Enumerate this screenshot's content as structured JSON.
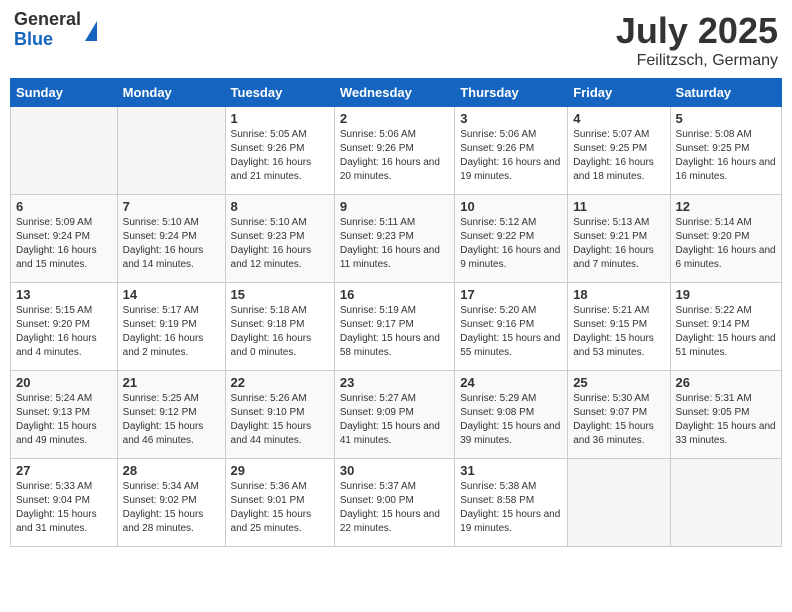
{
  "header": {
    "logo_general": "General",
    "logo_blue": "Blue",
    "title": "July 2025",
    "subtitle": "Feilitzsch, Germany"
  },
  "days_of_week": [
    "Sunday",
    "Monday",
    "Tuesday",
    "Wednesday",
    "Thursday",
    "Friday",
    "Saturday"
  ],
  "weeks": [
    [
      {
        "day": "",
        "sunrise": "",
        "sunset": "",
        "daylight": ""
      },
      {
        "day": "",
        "sunrise": "",
        "sunset": "",
        "daylight": ""
      },
      {
        "day": "1",
        "sunrise": "Sunrise: 5:05 AM",
        "sunset": "Sunset: 9:26 PM",
        "daylight": "Daylight: 16 hours and 21 minutes."
      },
      {
        "day": "2",
        "sunrise": "Sunrise: 5:06 AM",
        "sunset": "Sunset: 9:26 PM",
        "daylight": "Daylight: 16 hours and 20 minutes."
      },
      {
        "day": "3",
        "sunrise": "Sunrise: 5:06 AM",
        "sunset": "Sunset: 9:26 PM",
        "daylight": "Daylight: 16 hours and 19 minutes."
      },
      {
        "day": "4",
        "sunrise": "Sunrise: 5:07 AM",
        "sunset": "Sunset: 9:25 PM",
        "daylight": "Daylight: 16 hours and 18 minutes."
      },
      {
        "day": "5",
        "sunrise": "Sunrise: 5:08 AM",
        "sunset": "Sunset: 9:25 PM",
        "daylight": "Daylight: 16 hours and 16 minutes."
      }
    ],
    [
      {
        "day": "6",
        "sunrise": "Sunrise: 5:09 AM",
        "sunset": "Sunset: 9:24 PM",
        "daylight": "Daylight: 16 hours and 15 minutes."
      },
      {
        "day": "7",
        "sunrise": "Sunrise: 5:10 AM",
        "sunset": "Sunset: 9:24 PM",
        "daylight": "Daylight: 16 hours and 14 minutes."
      },
      {
        "day": "8",
        "sunrise": "Sunrise: 5:10 AM",
        "sunset": "Sunset: 9:23 PM",
        "daylight": "Daylight: 16 hours and 12 minutes."
      },
      {
        "day": "9",
        "sunrise": "Sunrise: 5:11 AM",
        "sunset": "Sunset: 9:23 PM",
        "daylight": "Daylight: 16 hours and 11 minutes."
      },
      {
        "day": "10",
        "sunrise": "Sunrise: 5:12 AM",
        "sunset": "Sunset: 9:22 PM",
        "daylight": "Daylight: 16 hours and 9 minutes."
      },
      {
        "day": "11",
        "sunrise": "Sunrise: 5:13 AM",
        "sunset": "Sunset: 9:21 PM",
        "daylight": "Daylight: 16 hours and 7 minutes."
      },
      {
        "day": "12",
        "sunrise": "Sunrise: 5:14 AM",
        "sunset": "Sunset: 9:20 PM",
        "daylight": "Daylight: 16 hours and 6 minutes."
      }
    ],
    [
      {
        "day": "13",
        "sunrise": "Sunrise: 5:15 AM",
        "sunset": "Sunset: 9:20 PM",
        "daylight": "Daylight: 16 hours and 4 minutes."
      },
      {
        "day": "14",
        "sunrise": "Sunrise: 5:17 AM",
        "sunset": "Sunset: 9:19 PM",
        "daylight": "Daylight: 16 hours and 2 minutes."
      },
      {
        "day": "15",
        "sunrise": "Sunrise: 5:18 AM",
        "sunset": "Sunset: 9:18 PM",
        "daylight": "Daylight: 16 hours and 0 minutes."
      },
      {
        "day": "16",
        "sunrise": "Sunrise: 5:19 AM",
        "sunset": "Sunset: 9:17 PM",
        "daylight": "Daylight: 15 hours and 58 minutes."
      },
      {
        "day": "17",
        "sunrise": "Sunrise: 5:20 AM",
        "sunset": "Sunset: 9:16 PM",
        "daylight": "Daylight: 15 hours and 55 minutes."
      },
      {
        "day": "18",
        "sunrise": "Sunrise: 5:21 AM",
        "sunset": "Sunset: 9:15 PM",
        "daylight": "Daylight: 15 hours and 53 minutes."
      },
      {
        "day": "19",
        "sunrise": "Sunrise: 5:22 AM",
        "sunset": "Sunset: 9:14 PM",
        "daylight": "Daylight: 15 hours and 51 minutes."
      }
    ],
    [
      {
        "day": "20",
        "sunrise": "Sunrise: 5:24 AM",
        "sunset": "Sunset: 9:13 PM",
        "daylight": "Daylight: 15 hours and 49 minutes."
      },
      {
        "day": "21",
        "sunrise": "Sunrise: 5:25 AM",
        "sunset": "Sunset: 9:12 PM",
        "daylight": "Daylight: 15 hours and 46 minutes."
      },
      {
        "day": "22",
        "sunrise": "Sunrise: 5:26 AM",
        "sunset": "Sunset: 9:10 PM",
        "daylight": "Daylight: 15 hours and 44 minutes."
      },
      {
        "day": "23",
        "sunrise": "Sunrise: 5:27 AM",
        "sunset": "Sunset: 9:09 PM",
        "daylight": "Daylight: 15 hours and 41 minutes."
      },
      {
        "day": "24",
        "sunrise": "Sunrise: 5:29 AM",
        "sunset": "Sunset: 9:08 PM",
        "daylight": "Daylight: 15 hours and 39 minutes."
      },
      {
        "day": "25",
        "sunrise": "Sunrise: 5:30 AM",
        "sunset": "Sunset: 9:07 PM",
        "daylight": "Daylight: 15 hours and 36 minutes."
      },
      {
        "day": "26",
        "sunrise": "Sunrise: 5:31 AM",
        "sunset": "Sunset: 9:05 PM",
        "daylight": "Daylight: 15 hours and 33 minutes."
      }
    ],
    [
      {
        "day": "27",
        "sunrise": "Sunrise: 5:33 AM",
        "sunset": "Sunset: 9:04 PM",
        "daylight": "Daylight: 15 hours and 31 minutes."
      },
      {
        "day": "28",
        "sunrise": "Sunrise: 5:34 AM",
        "sunset": "Sunset: 9:02 PM",
        "daylight": "Daylight: 15 hours and 28 minutes."
      },
      {
        "day": "29",
        "sunrise": "Sunrise: 5:36 AM",
        "sunset": "Sunset: 9:01 PM",
        "daylight": "Daylight: 15 hours and 25 minutes."
      },
      {
        "day": "30",
        "sunrise": "Sunrise: 5:37 AM",
        "sunset": "Sunset: 9:00 PM",
        "daylight": "Daylight: 15 hours and 22 minutes."
      },
      {
        "day": "31",
        "sunrise": "Sunrise: 5:38 AM",
        "sunset": "Sunset: 8:58 PM",
        "daylight": "Daylight: 15 hours and 19 minutes."
      },
      {
        "day": "",
        "sunrise": "",
        "sunset": "",
        "daylight": ""
      },
      {
        "day": "",
        "sunrise": "",
        "sunset": "",
        "daylight": ""
      }
    ]
  ]
}
